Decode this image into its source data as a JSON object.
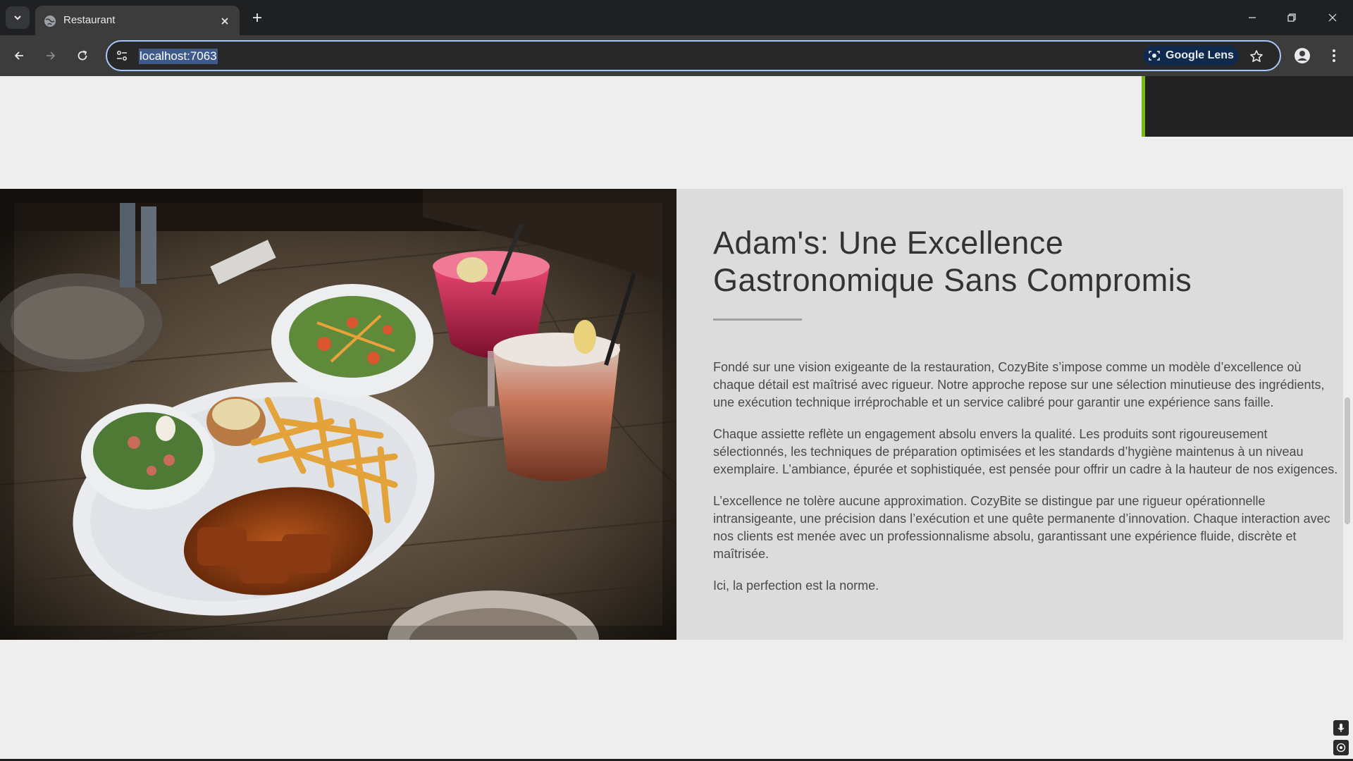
{
  "browser": {
    "tab_title": "Restaurant",
    "url": "localhost:7063",
    "lens_label": "Google Lens"
  },
  "colors": {
    "accent_green": "#7cb518",
    "omnibox_border": "#a8c7fa",
    "section_bg": "#dcdcdc"
  },
  "icons": {
    "tab_menu": "chevron-down-icon",
    "favicon": "globe-icon",
    "close": "close-icon",
    "new_tab": "plus-icon",
    "back": "arrow-left-icon",
    "forward": "arrow-right-icon",
    "reload": "reload-icon",
    "site_info": "tune-icon",
    "lens": "camera-search-icon",
    "bookmark": "star-icon",
    "profile": "person-icon",
    "menu": "three-dots-icon",
    "mic": "microphone-icon",
    "target": "target-icon"
  },
  "about": {
    "heading_line1": "Adam's: Une Excellence",
    "heading_line2": "Gastronomique Sans Compromis",
    "paragraphs": [
      "Fondé sur une vision exigeante de la restauration, CozyBite s’impose comme un modèle d’excellence où chaque détail est maîtrisé avec rigueur. Notre approche repose sur une sélection minutieuse des ingrédients, une exécution technique irréprochable et un service calibré pour garantir une expérience sans faille.",
      "Chaque assiette reflète un engagement absolu envers la qualité. Les produits sont rigoureusement sélectionnés, les techniques de préparation optimisées et les standards d’hygiène maintenus à un niveau exemplaire. L’ambiance, épurée et sophistiquée, est pensée pour offrir un cadre à la hauteur de nos exigences.",
      "L’excellence ne tolère aucune approximation. CozyBite se distingue par une rigueur opérationnelle intransigeante, une précision dans l’exécution et une quête permanente d’innovation. Chaque interaction avec nos clients est menée avec un professionnalisme absolu, garantissant une expérience fluide, discrète et maîtrisée.",
      "Ici, la perfection est la norme."
    ]
  }
}
